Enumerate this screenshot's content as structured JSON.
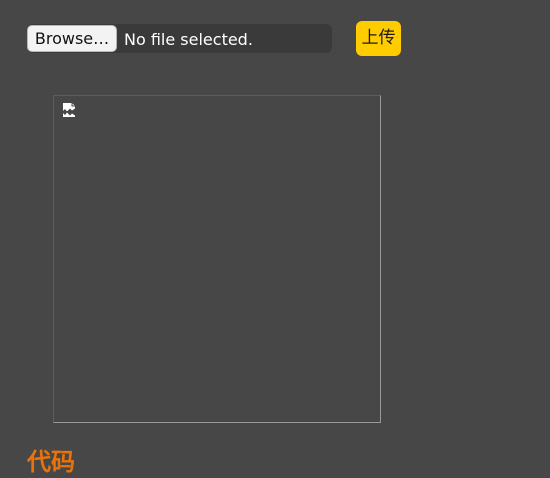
{
  "file_input": {
    "browse_label": "Browse…",
    "status_text": "No file selected."
  },
  "upload_button": {
    "label": "上传"
  },
  "preview": {
    "icon": "broken-image-icon"
  },
  "section": {
    "heading": "代码"
  },
  "colors": {
    "background": "#474747",
    "accent": "#ffcc00",
    "heading": "#e8730c"
  }
}
